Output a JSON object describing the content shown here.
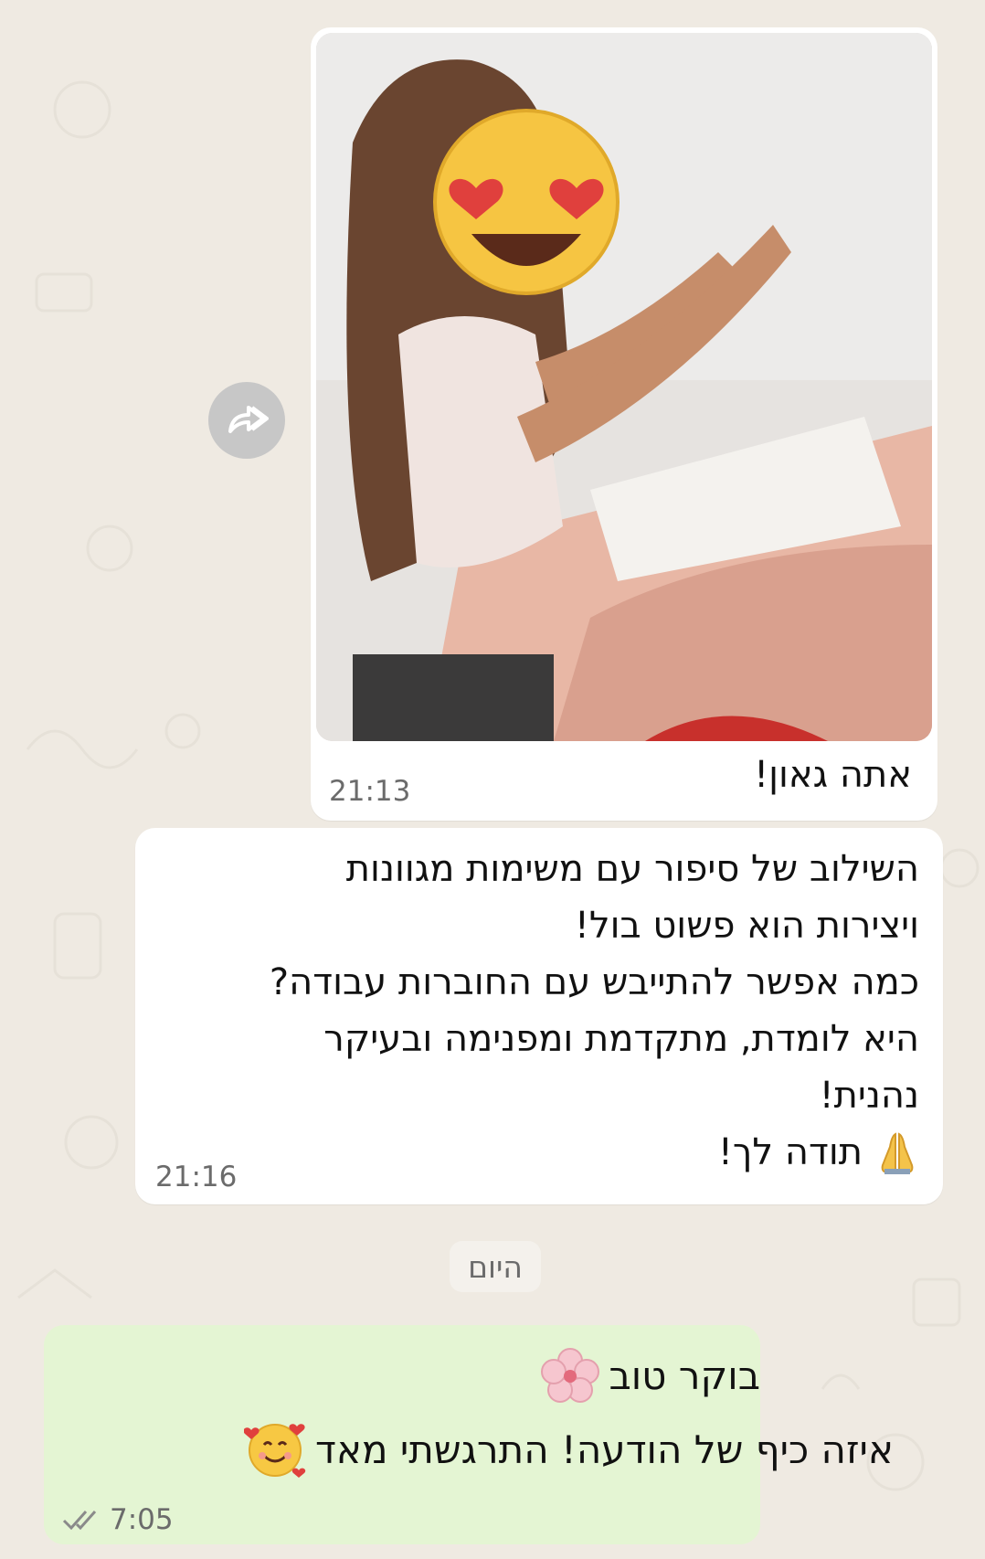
{
  "messages": [
    {
      "type": "image",
      "caption": "אתה גאון!",
      "time": "21:13"
    },
    {
      "type": "text",
      "lines": [
        "השילוב של סיפור עם משימות מגוונות",
        "ויצירות הוא פשוט בול!",
        "כמה אפשר להתייבש עם החוברות עבודה?",
        "היא לומדת, מתקדמת ומפנימה ובעיקר",
        "נהנית!",
        "תודה לך!"
      ],
      "time": "21:16",
      "last_line_icon": "praying-hands-icon"
    }
  ],
  "date_separator": "היום",
  "outgoing": {
    "line1": "בוקר טוב",
    "line1_icon": "cherry-blossom-icon",
    "line2": "איזה כיף של הודעה! התרגשתי מאד",
    "line2_icon": "smiling-face-with-hearts-icon",
    "time": "7:05",
    "status_icon": "double-check-icon"
  },
  "colors": {
    "background": "#efeae2",
    "incoming_bubble": "#ffffff",
    "outgoing_bubble": "#e4f5d3"
  }
}
